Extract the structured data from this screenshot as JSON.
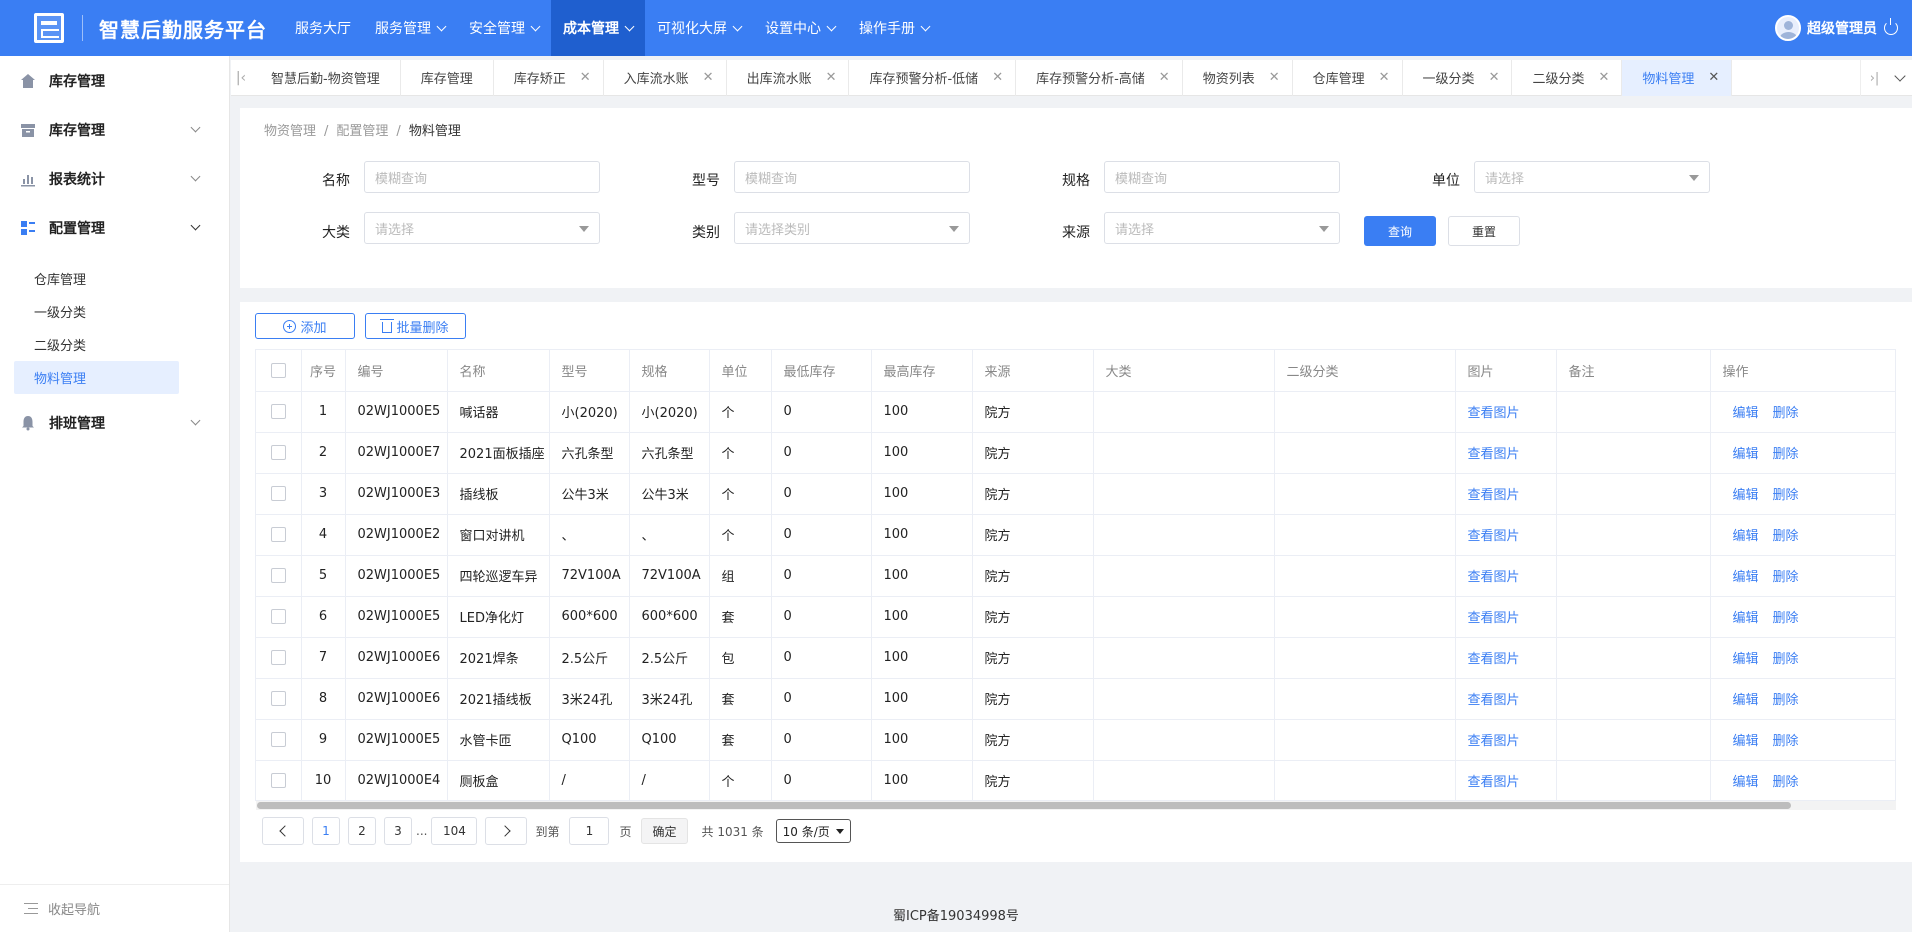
{
  "app": {
    "title": "智慧后勤服务平台"
  },
  "topnav": [
    {
      "label": "服务大厅",
      "dropdown": false,
      "active": false
    },
    {
      "label": "服务管理",
      "dropdown": true,
      "active": false
    },
    {
      "label": "安全管理",
      "dropdown": true,
      "active": false
    },
    {
      "label": "成本管理",
      "dropdown": true,
      "active": true
    },
    {
      "label": "可视化大屏",
      "dropdown": true,
      "active": false
    },
    {
      "label": "设置中心",
      "dropdown": true,
      "active": false
    },
    {
      "label": "操作手册",
      "dropdown": true,
      "active": false
    }
  ],
  "user": {
    "name": "超级管理员"
  },
  "sidebar": {
    "groups": [
      {
        "label": "库存管理",
        "icon": "home-icon",
        "expandable": false
      },
      {
        "label": "库存管理",
        "icon": "archive-icon",
        "expandable": true
      },
      {
        "label": "报表统计",
        "icon": "bar-chart-icon",
        "expandable": true
      },
      {
        "label": "配置管理",
        "icon": "grid-list-icon",
        "expandable": true
      }
    ],
    "sub_items": [
      "仓库管理",
      "一级分类",
      "二级分类",
      "物料管理"
    ],
    "active_sub": "物料管理",
    "last_group": {
      "label": "排班管理",
      "icon": "bell-icon"
    },
    "collapse_label": "收起导航"
  },
  "tabs": [
    {
      "label": "智慧后勤-物资管理",
      "closable": false,
      "active": false
    },
    {
      "label": "库存管理",
      "closable": false,
      "active": false
    },
    {
      "label": "库存矫正",
      "closable": true,
      "active": false
    },
    {
      "label": "入库流水账",
      "closable": true,
      "active": false
    },
    {
      "label": "出库流水账",
      "closable": true,
      "active": false
    },
    {
      "label": "库存预警分析-低储",
      "closable": true,
      "active": false
    },
    {
      "label": "库存预警分析-高储",
      "closable": true,
      "active": false
    },
    {
      "label": "物资列表",
      "closable": true,
      "active": false
    },
    {
      "label": "仓库管理",
      "closable": true,
      "active": false
    },
    {
      "label": "一级分类",
      "closable": true,
      "active": false
    },
    {
      "label": "二级分类",
      "closable": true,
      "active": false
    },
    {
      "label": "物料管理",
      "closable": true,
      "active": true
    }
  ],
  "breadcrumb": [
    "物资管理",
    "配置管理",
    "物料管理"
  ],
  "filters": {
    "name": {
      "label": "名称",
      "placeholder": "模糊查询"
    },
    "model": {
      "label": "型号",
      "placeholder": "模糊查询"
    },
    "spec": {
      "label": "规格",
      "placeholder": "模糊查询"
    },
    "unit": {
      "label": "单位",
      "placeholder": "请选择"
    },
    "category": {
      "label": "大类",
      "placeholder": "请选择"
    },
    "type": {
      "label": "类别",
      "placeholder": "请选择类别"
    },
    "source": {
      "label": "来源",
      "placeholder": "请选择"
    },
    "query_label": "查询",
    "reset_label": "重置"
  },
  "toolbar": {
    "add_label": "添加",
    "batch_delete_label": "批量删除"
  },
  "table": {
    "columns": [
      "序号",
      "编号",
      "名称",
      "型号",
      "规格",
      "单位",
      "最低库存",
      "最高库存",
      "来源",
      "大类",
      "二级分类",
      "图片",
      "备注",
      "操作"
    ],
    "rows": [
      {
        "idx": "1",
        "code": "02WJ1000E5",
        "name": "喊话器",
        "model": "小(2020)",
        "spec": "小(2020)",
        "unit": "个",
        "min": "0",
        "max": "100",
        "source": "院方",
        "cat": "",
        "cat2": "",
        "img": "查看图片",
        "note": ""
      },
      {
        "idx": "2",
        "code": "02WJ1000E7",
        "name": "2021面板插座",
        "model": "六孔条型",
        "spec": "六孔条型",
        "unit": "个",
        "min": "0",
        "max": "100",
        "source": "院方",
        "cat": "",
        "cat2": "",
        "img": "查看图片",
        "note": ""
      },
      {
        "idx": "3",
        "code": "02WJ1000E3",
        "name": "插线板",
        "model": "公牛3米",
        "spec": "公牛3米",
        "unit": "个",
        "min": "0",
        "max": "100",
        "source": "院方",
        "cat": "",
        "cat2": "",
        "img": "查看图片",
        "note": ""
      },
      {
        "idx": "4",
        "code": "02WJ1000E2",
        "name": "窗口对讲机",
        "model": "、",
        "spec": "、",
        "unit": "个",
        "min": "0",
        "max": "100",
        "source": "院方",
        "cat": "",
        "cat2": "",
        "img": "查看图片",
        "note": ""
      },
      {
        "idx": "5",
        "code": "02WJ1000E5",
        "name": "四轮巡逻车异",
        "model": "72V100A",
        "spec": "72V100A",
        "unit": "组",
        "min": "0",
        "max": "100",
        "source": "院方",
        "cat": "",
        "cat2": "",
        "img": "查看图片",
        "note": ""
      },
      {
        "idx": "6",
        "code": "02WJ1000E5",
        "name": "LED净化灯",
        "model": "600*600",
        "spec": "600*600",
        "unit": "套",
        "min": "0",
        "max": "100",
        "source": "院方",
        "cat": "",
        "cat2": "",
        "img": "查看图片",
        "note": ""
      },
      {
        "idx": "7",
        "code": "02WJ1000E6",
        "name": "2021焊条",
        "model": "2.5公斤",
        "spec": "2.5公斤",
        "unit": "包",
        "min": "0",
        "max": "100",
        "source": "院方",
        "cat": "",
        "cat2": "",
        "img": "查看图片",
        "note": ""
      },
      {
        "idx": "8",
        "code": "02WJ1000E6",
        "name": "2021插线板",
        "model": "3米24孔",
        "spec": "3米24孔",
        "unit": "套",
        "min": "0",
        "max": "100",
        "source": "院方",
        "cat": "",
        "cat2": "",
        "img": "查看图片",
        "note": ""
      },
      {
        "idx": "9",
        "code": "02WJ1000E5",
        "name": "水管卡匝",
        "model": "Q100",
        "spec": "Q100",
        "unit": "套",
        "min": "0",
        "max": "100",
        "source": "院方",
        "cat": "",
        "cat2": "",
        "img": "查看图片",
        "note": ""
      },
      {
        "idx": "10",
        "code": "02WJ1000E4",
        "name": "厕板盒",
        "model": "/",
        "spec": "/",
        "unit": "个",
        "min": "0",
        "max": "100",
        "source": "院方",
        "cat": "",
        "cat2": "",
        "img": "查看图片",
        "note": ""
      }
    ],
    "edit_label": "编辑",
    "delete_label": "删除"
  },
  "pagination": {
    "pages": [
      "1",
      "2",
      "3"
    ],
    "ellipsis": "...",
    "last_page": "104",
    "current": "1",
    "goto_prefix": "到第",
    "goto_value": "1",
    "goto_suffix": "页",
    "confirm_label": "确定",
    "total_text": "共 1031 条",
    "page_size": "10 条/页"
  },
  "footer": {
    "icp": "蜀ICP备19034998号"
  },
  "colors": {
    "primary": "#3a7ef3",
    "header_active": "#1f5fcf",
    "tab_active_bg": "#e6efff"
  }
}
